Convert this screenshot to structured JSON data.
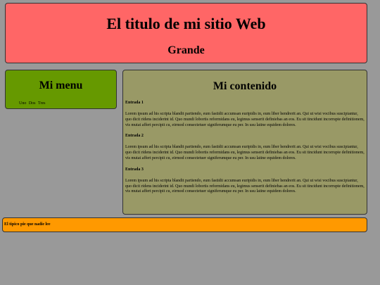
{
  "header": {
    "title": "El titulo de mi sitio Web",
    "subtitle": "Grande"
  },
  "menu": {
    "title": "Mi menu",
    "items": [
      "Uno",
      "Dos",
      "Tres"
    ]
  },
  "content": {
    "title": "Mi contenido",
    "entries": [
      {
        "title": "Entrada 1",
        "text": "Lorem ipsum ad his scripta blandit partiendo, eum fastidii accumsan euripidis in, eum liber hendrerit an. Qui ut wisi vocibus suscipiantur, quo dicit ridens inciderint id. Quo mundi lobortis reformidans eu, legimus senserit definiebas an eos. Eu sit tincidunt incorrupte definitionem, vis mutat affert percipit cu, eirmod consectetuer signiferumque eu per. In usu latine equidem dolores."
      },
      {
        "title": "Entrada 2",
        "text": "Lorem ipsum ad his scripta blandit partiendo, eum fastidii accumsan euripidis in, eum liber hendrerit an. Qui ut wisi vocibus suscipiantur, quo dicit ridens inciderint id. Quo mundi lobortis reformidans eu, legimus senserit definiebas an eos. Eu sit tincidunt incorrupte definitionem, vis mutat affert percipit cu, eirmod consectetuer signiferumque eu per. In usu latine equidem dolores."
      },
      {
        "title": "Entrada 3",
        "text": "Lorem ipsum ad his scripta blandit partiendo, eum fastidii accumsan euripidis in, eum liber hendrerit an. Qui ut wisi vocibus suscipiantur, quo dicit ridens inciderint id. Quo mundi lobortis reformidans eu, legimus senserit definiebas an eos. Eu sit tincidunt incorrupte definitionem, vis mutat affert percipit cu, eirmod consectetuer signiferumque eu per. In usu latine equidem dolores."
      }
    ]
  },
  "footer": {
    "text": "El tipico pie que nadie lee"
  },
  "colors": {
    "page_background": "#999999",
    "header": "#ff6666",
    "menu": "#669900",
    "content": "#999966",
    "footer": "#ff9900"
  }
}
